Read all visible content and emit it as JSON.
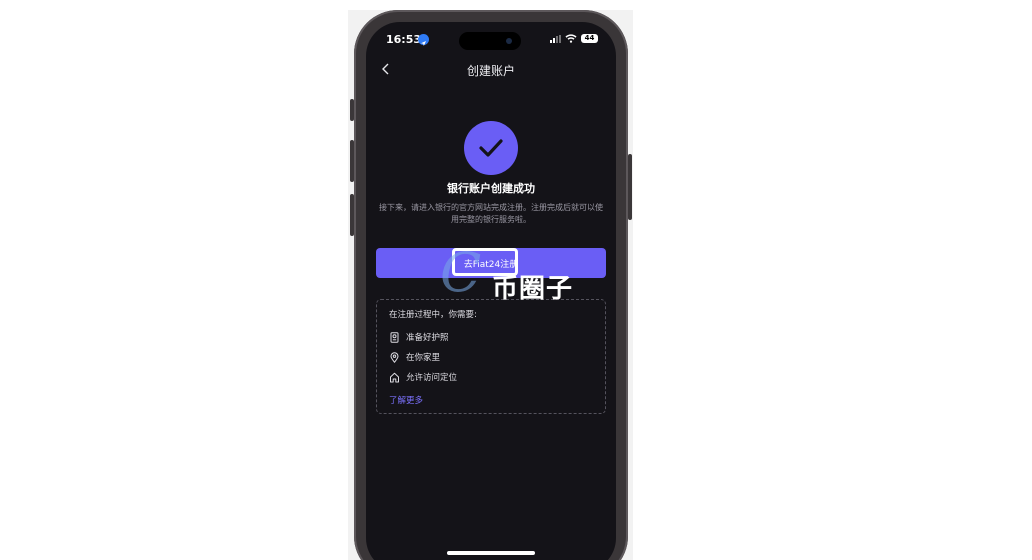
{
  "status_bar": {
    "time": "16:53",
    "battery": "44"
  },
  "header": {
    "title": "创建账户"
  },
  "success": {
    "title": "银行账户创建成功",
    "description": "接下来，请进入银行的官方网站完成注册。注册完成后就可以使用完整的银行服务啦。"
  },
  "cta": {
    "label": "去Fiat24注册"
  },
  "requirements": {
    "heading": "在注册过程中，你需要:",
    "items": [
      {
        "label": "准备好护照",
        "icon": "passport-icon"
      },
      {
        "label": "在你家里",
        "icon": "location-pin-icon"
      },
      {
        "label": "允许访问定位",
        "icon": "home-icon"
      }
    ],
    "learn_more": "了解更多"
  },
  "watermark": {
    "text": "币圈子"
  },
  "colors": {
    "accent": "#6a5ef5",
    "background": "#141318",
    "link": "#7c72ff"
  }
}
